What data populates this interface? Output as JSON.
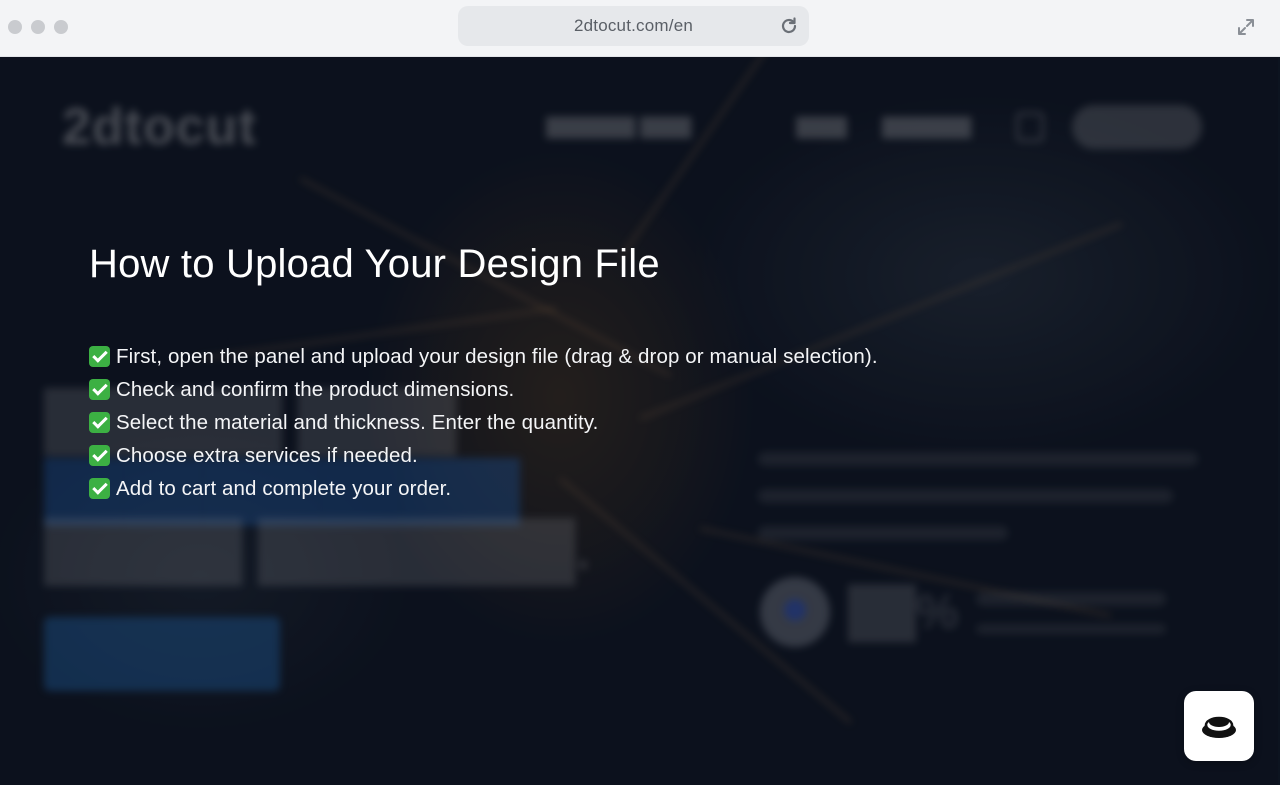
{
  "browser": {
    "url": "2dtocut.com/en"
  },
  "background": {
    "logo": "2dtocut"
  },
  "overlay": {
    "title": "How to Upload Your Design File",
    "steps": [
      "First, open the panel and upload your design file (drag & drop or manual selection).",
      "Check and confirm the product dimensions.",
      "Select the material and thickness. Enter the quantity.",
      "Choose extra services if needed.",
      "Add to cart and complete your order."
    ]
  },
  "icons": {
    "check": "check-mark-icon",
    "reload": "reload-icon",
    "expand": "expand-icon",
    "chat": "chat-icon"
  },
  "colors": {
    "check_green": "#3cb043",
    "overlay_bg": "#0d1420"
  }
}
